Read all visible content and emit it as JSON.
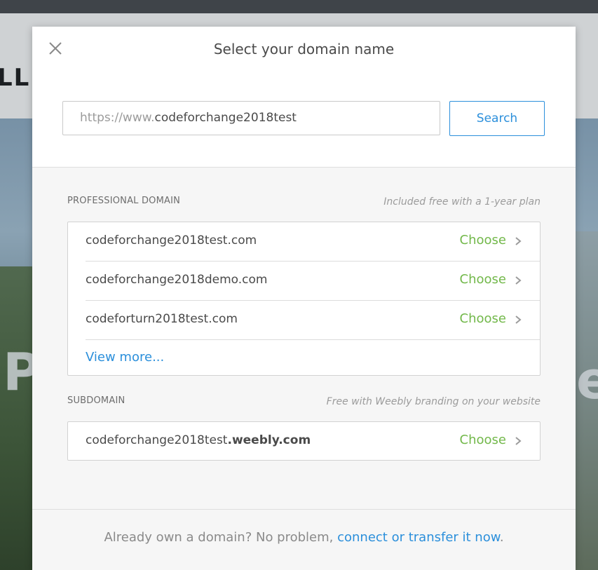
{
  "background": {
    "header_text": "LL",
    "hero_letter_left": "P",
    "hero_letter_right": "e"
  },
  "modal": {
    "title": "Select your domain name",
    "close_icon": "close-icon",
    "url_prefix": "https://www.",
    "url_value": "codeforchange2018test",
    "search_label": "Search"
  },
  "professional": {
    "label": "PROFESSIONAL DOMAIN",
    "note": "Included free with a 1-year plan",
    "domains": [
      {
        "name": "codeforchange2018test.com",
        "action": "Choose"
      },
      {
        "name": "codeforchange2018demo.com",
        "action": "Choose"
      },
      {
        "name": "codeforturn2018test.com",
        "action": "Choose"
      }
    ],
    "view_more": "View more..."
  },
  "subdomain": {
    "label": "SUBDOMAIN",
    "note": "Free with Weebly branding on your website",
    "name_prefix": "codeforchange2018test",
    "name_suffix": ".weebly.com",
    "action": "Choose"
  },
  "footer": {
    "text": "Already own a domain? No problem, ",
    "link": "connect or transfer it now",
    "period": "."
  },
  "colors": {
    "accent_blue": "#2b8fdb",
    "choose_green": "#72b84a"
  }
}
